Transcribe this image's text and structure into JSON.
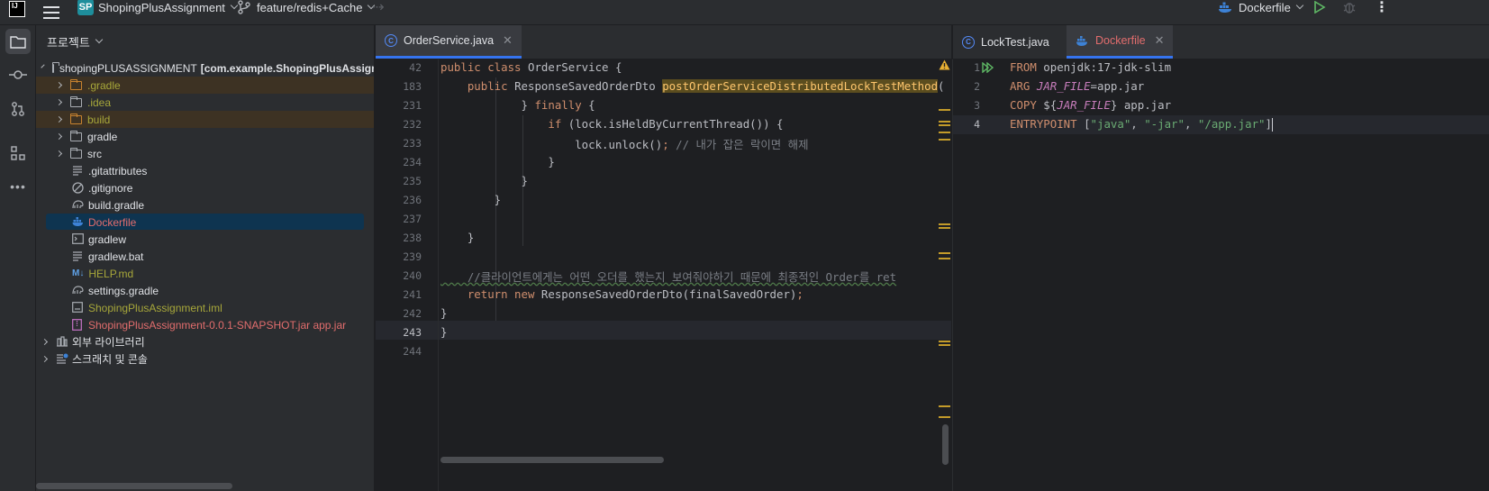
{
  "titlebar": {
    "logo_text": "IJ",
    "project_badge": "SP",
    "project_name": "ShopingPlusAssignment",
    "branch": "feature/redis+Cache",
    "run_config": "Dockerfile"
  },
  "project_panel": {
    "header": "프로젝트",
    "root_label": "shopingPLUSASSIGNMENT",
    "root_module": "[com.example.ShopingPlusAssignment]",
    "items": [
      {
        "label": ".gradle"
      },
      {
        "label": ".idea"
      },
      {
        "label": "build"
      },
      {
        "label": "gradle"
      },
      {
        "label": "src"
      },
      {
        "label": ".gitattributes"
      },
      {
        "label": ".gitignore"
      },
      {
        "label": "build.gradle"
      },
      {
        "label": "Dockerfile"
      },
      {
        "label": "gradlew"
      },
      {
        "label": "gradlew.bat"
      },
      {
        "label": "HELP.md",
        "icon_text": "M↓"
      },
      {
        "label": "settings.gradle"
      },
      {
        "label": "ShopingPlusAssignment.iml"
      },
      {
        "label": "ShopingPlusAssignment-0.0.1-SNAPSHOT.jar app.jar"
      }
    ],
    "external_libraries": "외부 라이브러리",
    "scratches": "스크래치 및 콘솔"
  },
  "left_editor": {
    "tab": "OrderService.java",
    "tab_icon_text": "C",
    "line_numbers": [
      "42",
      "183",
      "231",
      "232",
      "233",
      "234",
      "235",
      "236",
      "237",
      "238",
      "239",
      "240",
      "241",
      "242",
      "243",
      "244"
    ],
    "code": {
      "l42_a": "public class ",
      "l42_b": "OrderService {",
      "l183_a": "    public ",
      "l183_b": "ResponseSavedOrderDto ",
      "l183_c": "postOrderServiceDistributedLockTestMethod",
      "l183_d": "(",
      "l231_a": "            } ",
      "l231_b": "finally",
      "l231_c": " {",
      "l232_a": "                ",
      "l232_b": "if",
      "l232_c": " (lock.isHeldByCurrentThread()) {",
      "l233_a": "                    lock.unlock()",
      "l233_b": ";",
      "l233_c": " // 내가 잡은 락이면 해제",
      "l234": "                }",
      "l235": "            }",
      "l236": "        }",
      "l238": "    }",
      "l240_a": "    //클라이언트에게는 어떤 오더를 했는지 보여줘야하기 때문에 최종적인 Order를 ret",
      "l241_a": "    ",
      "l241_b": "return new",
      "l241_c": " ResponseSavedOrderDto(finalSavedOrder)",
      "l241_d": ";",
      "l242": "}",
      "l243": "}"
    }
  },
  "right_editor": {
    "tabs": [
      {
        "label": "LockTest.java",
        "icon_text": "C"
      },
      {
        "label": "Dockerfile"
      }
    ],
    "line_numbers": [
      "1",
      "2",
      "3",
      "4"
    ],
    "code": {
      "l1_a": "FROM",
      "l1_b": " openjdk:17-jdk-slim",
      "l2_a": "ARG",
      "l2_b": "JAR_FILE",
      "l2_c": "=app.jar",
      "l3_a": "COPY",
      "l3_b": " ${",
      "l3_c": "JAR_FILE",
      "l3_d": "} app.jar",
      "l4_a": "ENTRYPOINT",
      "l4_b": " [",
      "l4_c": "\"java\"",
      "l4_d": ", ",
      "l4_e": "\"-jar\"",
      "l4_f": ", ",
      "l4_g": "\"/app.jar\"",
      "l4_h": "]"
    }
  },
  "colors": {
    "accent": "#3574f0",
    "warning": "#e8b033",
    "run_green": "#5fb865"
  }
}
